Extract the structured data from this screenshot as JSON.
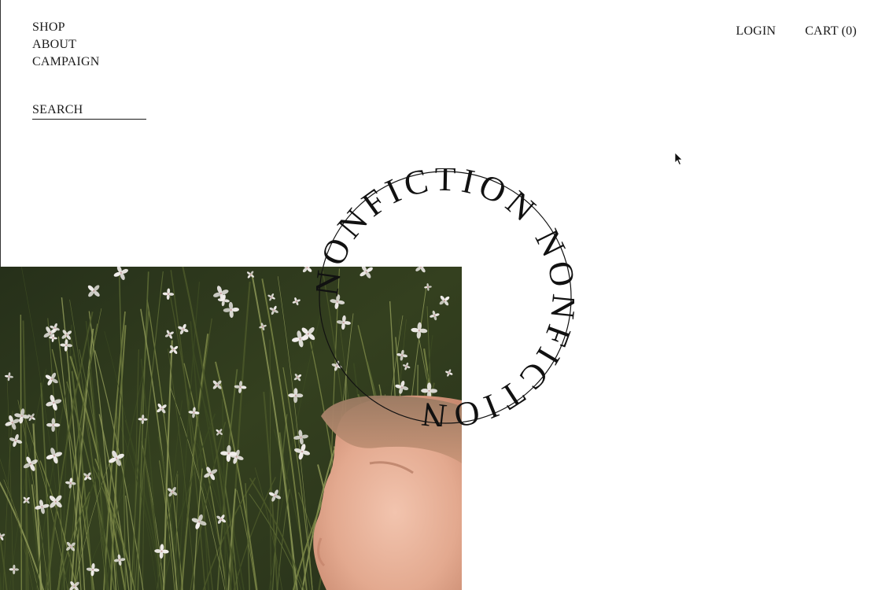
{
  "nav": {
    "items": [
      {
        "label": "SHOP"
      },
      {
        "label": "ABOUT"
      },
      {
        "label": "CAMPAIGN"
      }
    ]
  },
  "search": {
    "placeholder": "SEARCH"
  },
  "account": {
    "login_label": "LOGIN",
    "cart_label": "CART (0)"
  },
  "emblem": {
    "text": "NONFICTION NONFICTION "
  },
  "hero": {
    "image": "woman-in-wildflower-field"
  },
  "colors": {
    "text": "#1a1a1a",
    "background": "#ffffff",
    "foliage": "#2f3a1f",
    "flower": "#f4f0ee",
    "skin": "#e8b49c"
  }
}
